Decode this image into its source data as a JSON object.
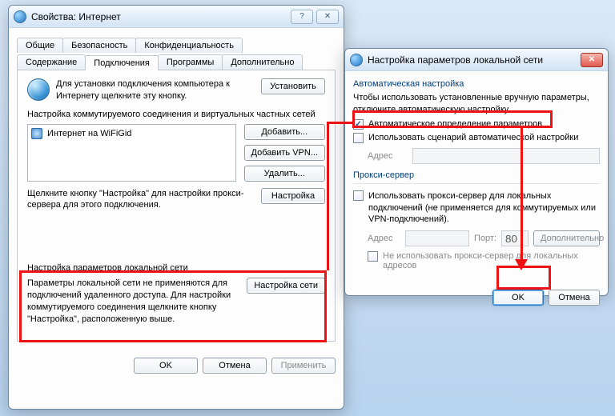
{
  "win1": {
    "title": "Свойства: Интернет",
    "tabs_row1": [
      "Общие",
      "Безопасность",
      "Конфиденциальность"
    ],
    "tabs_row2": [
      "Содержание",
      "Подключения",
      "Программы",
      "Дополнительно"
    ],
    "active_tab": "Подключения",
    "setup_desc": "Для установки подключения компьютера к Интернету щелкните эту кнопку.",
    "setup_btn": "Установить",
    "dial_label": "Настройка коммутируемого соединения и виртуальных частных сетей",
    "conn_item": "Интернет на WiFiGid",
    "add_btn": "Добавить...",
    "add_vpn_btn": "Добавить VPN...",
    "remove_btn": "Удалить...",
    "proxy_hint": "Щелкните кнопку \"Настройка\" для настройки прокси-сервера для этого подключения.",
    "settings_btn": "Настройка",
    "lan_label": "Настройка параметров локальной сети",
    "lan_desc": "Параметры локальной сети не применяются для подключений удаленного доступа. Для настройки коммутируемого соединения щелкните кнопку \"Настройка\", расположенную выше.",
    "lan_btn": "Настройка сети",
    "ok": "OK",
    "cancel": "Отмена",
    "apply": "Применить"
  },
  "win2": {
    "title": "Настройка параметров локальной сети",
    "auto_group": "Автоматическая настройка",
    "auto_desc": "Чтобы использовать установленные вручную параметры, отключите автоматическую настройку.",
    "auto_detect": "Автоматическое определение параметров",
    "use_script": "Использовать сценарий автоматической настройки",
    "addr_label": "Адрес",
    "proxy_group": "Прокси-сервер",
    "use_proxy": "Использовать прокси-сервер для локальных подключений (не применяется для коммутируемых или VPN-подключений).",
    "port_label": "Порт:",
    "port_value": "80",
    "advanced_btn": "Дополнительно",
    "bypass_local": "Не использовать прокси-сервер для локальных адресов",
    "ok": "OK",
    "cancel": "Отмена"
  }
}
